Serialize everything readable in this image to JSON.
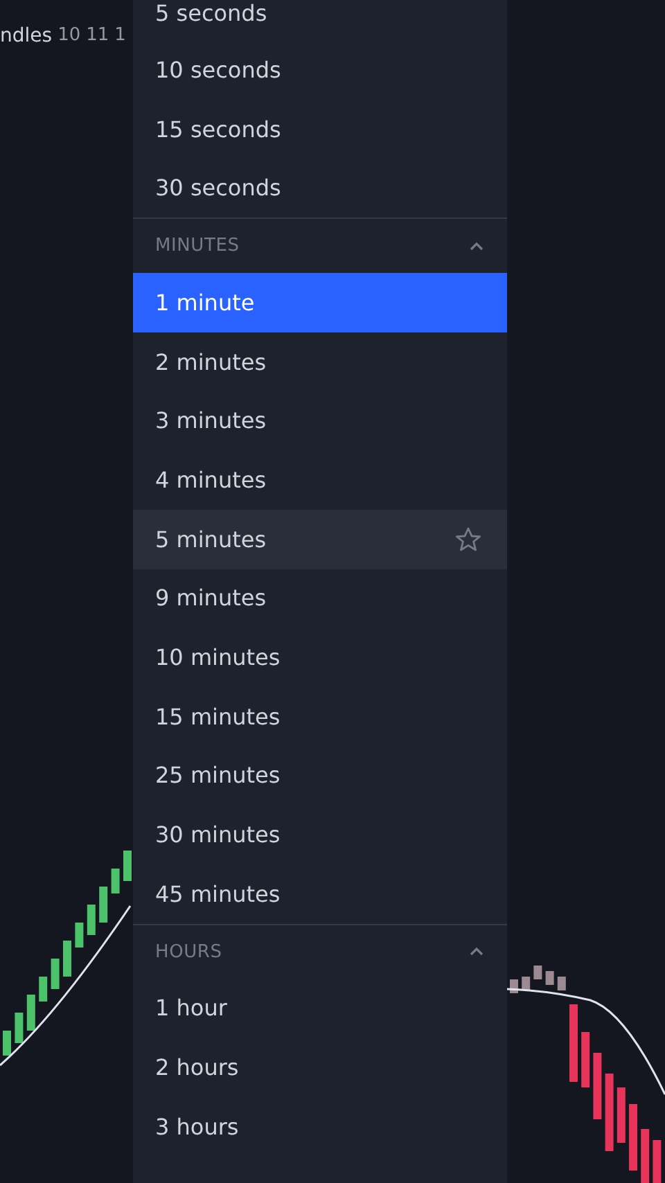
{
  "chart_legend": [
    "ndles",
    "10",
    "11",
    "1"
  ],
  "sections": [
    {
      "kind": "plain",
      "items": [
        {
          "label": "5 seconds",
          "selected": false,
          "hovered": false
        },
        {
          "label": "10 seconds",
          "selected": false,
          "hovered": false
        },
        {
          "label": "15 seconds",
          "selected": false,
          "hovered": false
        },
        {
          "label": "30 seconds",
          "selected": false,
          "hovered": false
        }
      ]
    },
    {
      "kind": "group",
      "title": "MINUTES",
      "expanded": true,
      "items": [
        {
          "label": "1 minute",
          "selected": true,
          "hovered": false
        },
        {
          "label": "2 minutes",
          "selected": false,
          "hovered": false
        },
        {
          "label": "3 minutes",
          "selected": false,
          "hovered": false
        },
        {
          "label": "4 minutes",
          "selected": false,
          "hovered": false
        },
        {
          "label": "5 minutes",
          "selected": false,
          "hovered": true
        },
        {
          "label": "9 minutes",
          "selected": false,
          "hovered": false
        },
        {
          "label": "10 minutes",
          "selected": false,
          "hovered": false
        },
        {
          "label": "15 minutes",
          "selected": false,
          "hovered": false
        },
        {
          "label": "25 minutes",
          "selected": false,
          "hovered": false
        },
        {
          "label": "30 minutes",
          "selected": false,
          "hovered": false
        },
        {
          "label": "45 minutes",
          "selected": false,
          "hovered": false
        }
      ]
    },
    {
      "kind": "group",
      "title": "HOURS",
      "expanded": true,
      "items": [
        {
          "label": "1 hour",
          "selected": false,
          "hovered": false
        },
        {
          "label": "2 hours",
          "selected": false,
          "hovered": false
        },
        {
          "label": "3 hours",
          "selected": false,
          "hovered": false
        }
      ]
    }
  ]
}
